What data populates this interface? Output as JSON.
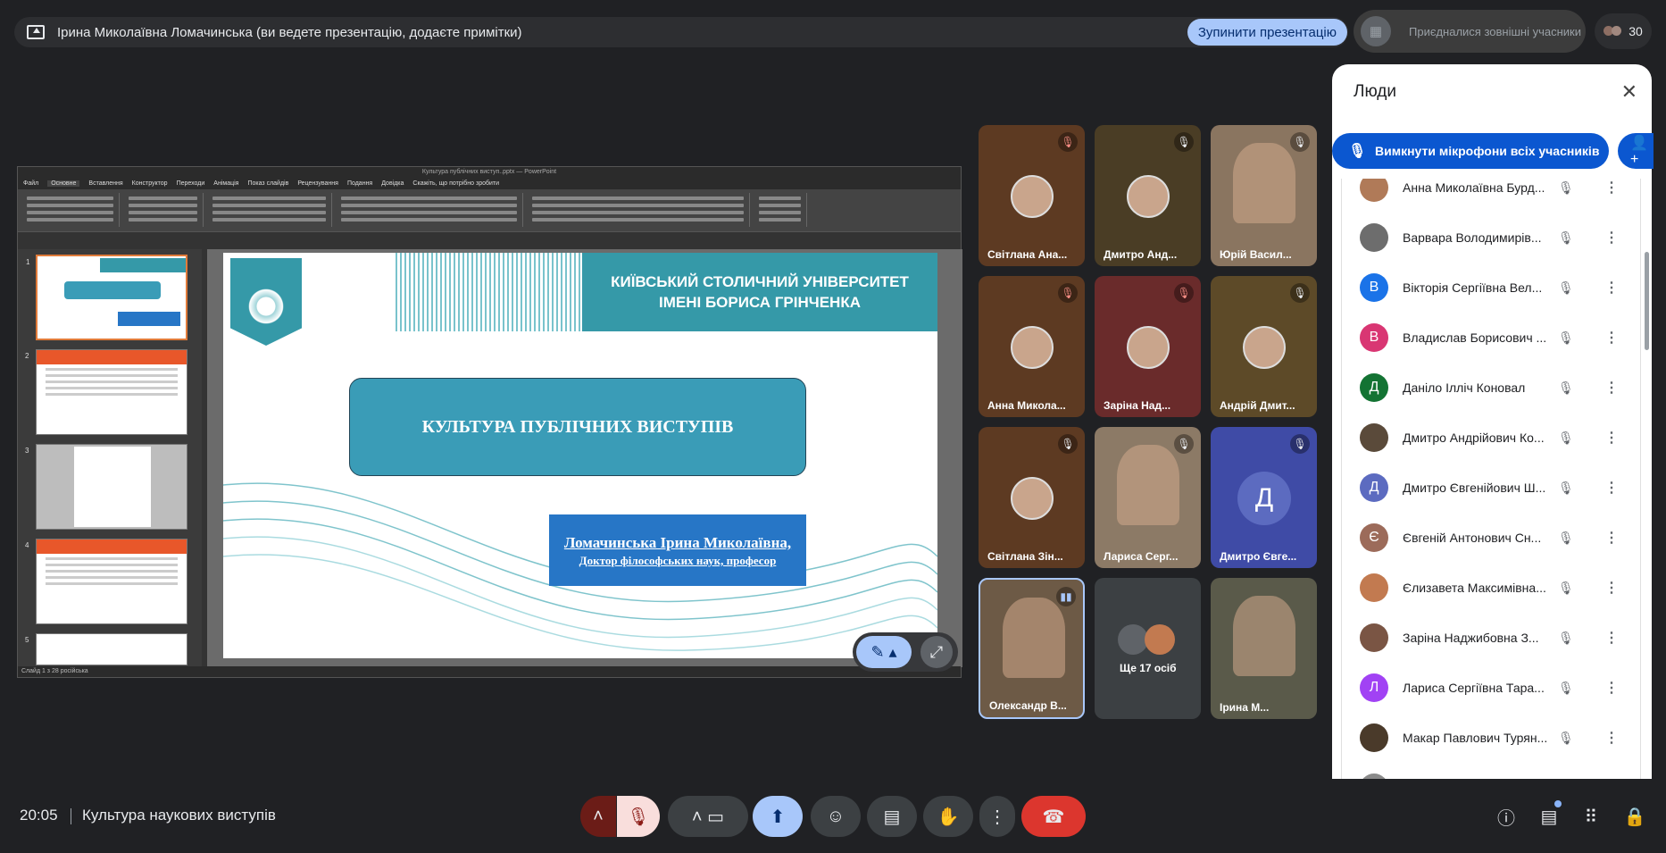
{
  "topbar": {
    "title": "Ірина Миколаївна Ломачинська (ви ведете презентацію, додаєте примітки)",
    "stop_label": "Зупинити презентацію",
    "external_label": "Приєдналися зовнішні учасники",
    "participant_count": "30"
  },
  "ppt": {
    "window_title": "Культура публічних виступ..pptx — PowerPoint",
    "menu": [
      "Файл",
      "Основне",
      "Вставлення",
      "Конструктор",
      "Переходи",
      "Анімація",
      "Показ слайдів",
      "Рецензування",
      "Подання",
      "Довідка",
      "Скажіть, що потрібно зробити"
    ],
    "thumb_numbers": [
      "1",
      "2",
      "3",
      "4",
      "5"
    ],
    "status": "Слайд 1 з 28    російська",
    "slide": {
      "header": "КИЇВСЬКИЙ СТОЛИЧНИЙ УНІВЕРСИТЕТ ІМЕНІ БОРИСА ГРІНЧЕНКА",
      "title": "КУЛЬТУРА ПУБЛІЧНИХ ВИСТУПІВ",
      "author": "Ломачинська Ірина Миколаївна,",
      "role": "Доктор філософських наук, професор"
    }
  },
  "tiles": [
    {
      "name": "Світлана Ана...",
      "color": "#5d3a22"
    },
    {
      "name": "Дмитро Анд...",
      "color": "#4a3d25"
    },
    {
      "name": "Юрій Васил...",
      "color": "#8a7560"
    },
    {
      "name": "Анна Микола...",
      "color": "#5d3a22"
    },
    {
      "name": "Заріна Над...",
      "color": "#6a2b2b"
    },
    {
      "name": "Андрій Дмит...",
      "color": "#5d4a28"
    },
    {
      "name": "Світлана Зін...",
      "color": "#5d3a22"
    },
    {
      "name": "Лариса Серг...",
      "color": "#8c7a66"
    },
    {
      "name": "Дмитро Євге...",
      "color": "#3f4ba6",
      "initial": "Д"
    },
    {
      "name": "Олександр В...",
      "color": "#6d5a46"
    },
    {
      "name": "Ще 17 осіб",
      "color": "#3c4043"
    },
    {
      "name": "Ірина М...",
      "color": "#5a5a4a"
    }
  ],
  "panel": {
    "title": "Люди",
    "mute_all": "Вимкнути мікрофони всіх учасників",
    "people": [
      {
        "name": "Анна Миколаївна Бурд...",
        "initial": "",
        "color": "#b07a58"
      },
      {
        "name": "Варвара Володимирів...",
        "initial": "",
        "color": "#6d6d6d"
      },
      {
        "name": "Вікторія Сергіївна Вел...",
        "initial": "В",
        "color": "#1a73e8"
      },
      {
        "name": "Владислав Борисович ...",
        "initial": "В",
        "color": "#d93673"
      },
      {
        "name": "Даніло Ілліч Коновал",
        "initial": "Д",
        "color": "#137333"
      },
      {
        "name": "Дмитро Андрійович Ко...",
        "initial": "",
        "color": "#5a4a3a"
      },
      {
        "name": "Дмитро Євгенійович Ш...",
        "initial": "Д",
        "color": "#5c6bc0"
      },
      {
        "name": "Євгеній Антонович Сн...",
        "initial": "Є",
        "color": "#9c6b5a"
      },
      {
        "name": "Єлизавета Максимівна...",
        "initial": "",
        "color": "#c27a50"
      },
      {
        "name": "Заріна Наджибовна З...",
        "initial": "",
        "color": "#7a5544"
      },
      {
        "name": "Лариса Сергіївна Тара...",
        "initial": "Л",
        "color": "#a142f4"
      },
      {
        "name": "Макар Павлович Турян...",
        "initial": "",
        "color": "#4a3a2a"
      },
      {
        "name": "",
        "initial": "",
        "color": "#8a8a8a"
      }
    ]
  },
  "bottom": {
    "time": "20:05",
    "meeting": "Культура наукових виступів"
  }
}
